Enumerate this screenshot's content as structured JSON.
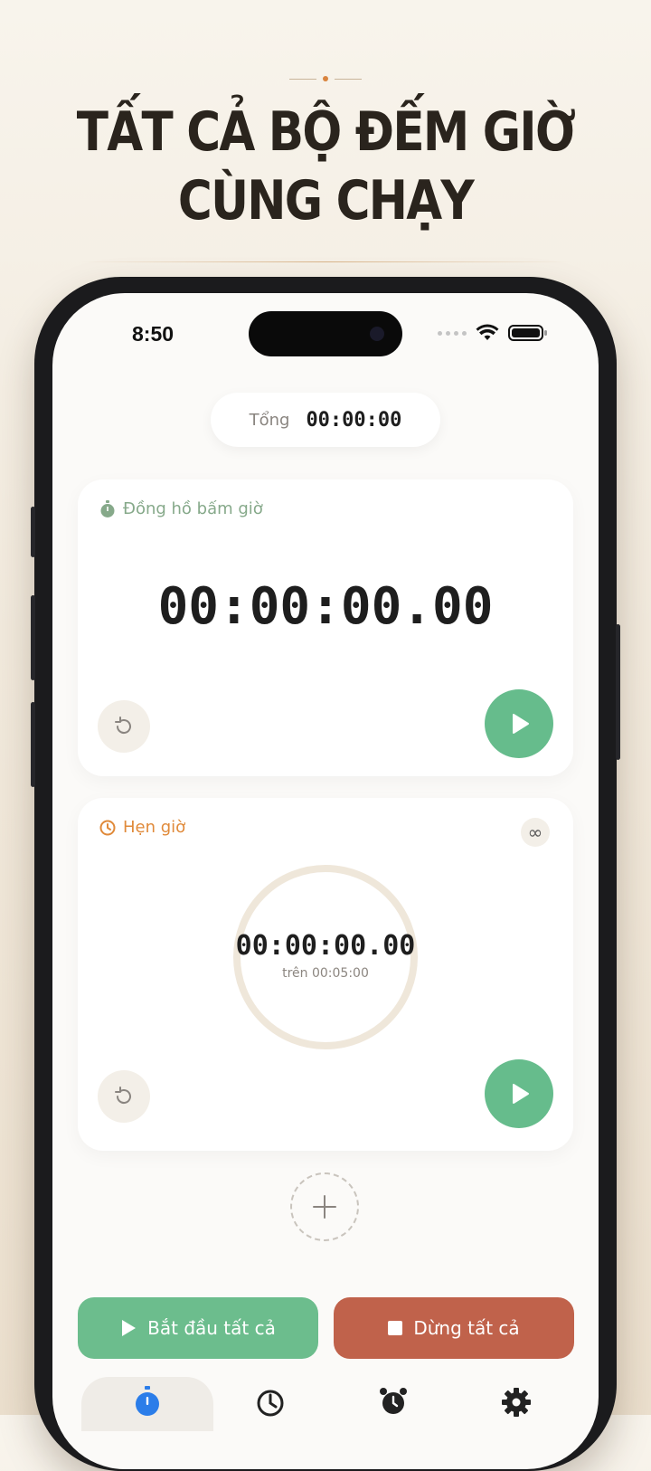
{
  "hero": {
    "line1": "TẤT CẢ BỘ ĐẾM GIỜ",
    "line2": "CÙNG CHẠY"
  },
  "status_bar": {
    "time": "8:50",
    "icons": [
      "wifi-icon",
      "battery-icon"
    ]
  },
  "summary": {
    "label": "Tổng",
    "value": "00:00:00"
  },
  "stopwatch": {
    "title": "Đồng hồ bấm giờ",
    "icon": "stopwatch-icon",
    "accent": "#86a98a",
    "time": "00:00:00.00"
  },
  "timer": {
    "title": "Hẹn giờ",
    "icon": "timer-icon",
    "accent": "#e08a3a",
    "time": "00:00:00.00",
    "target": "trên 00:05:00",
    "loop_symbol": "∞"
  },
  "actions": {
    "start_all": "Bắt đầu tất cả",
    "stop_all": "Dừng tất cả",
    "start_color": "#6cbd8d",
    "stop_color": "#c0624b"
  },
  "tabs": [
    {
      "icon": "stopwatch-icon",
      "active": true
    },
    {
      "icon": "timer-icon",
      "active": false
    },
    {
      "icon": "alarm-clock-icon",
      "active": false
    },
    {
      "icon": "gear-icon",
      "active": false
    }
  ]
}
